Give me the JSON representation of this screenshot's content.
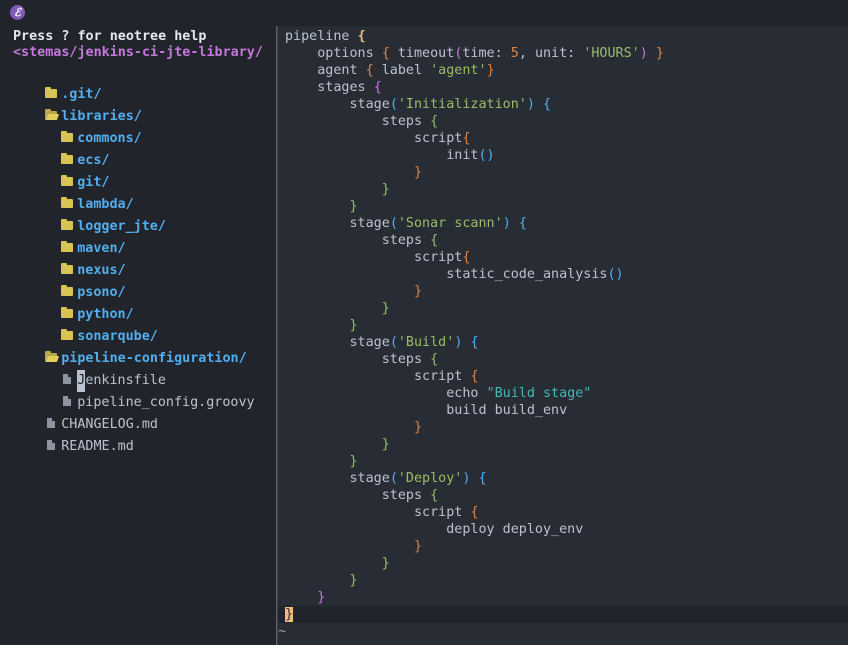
{
  "app": {
    "logo_glyph": "ℰ"
  },
  "sidebar": {
    "help_text": "Press ? for neotree help",
    "root": "<stemas/jenkins-ci-jte-library/",
    "entries": [
      {
        "label": ".git/",
        "type": "dir",
        "depth": 0
      },
      {
        "label": "libraries/",
        "type": "dir-open",
        "depth": 0
      },
      {
        "label": "commons/",
        "type": "dir",
        "depth": 1
      },
      {
        "label": "ecs/",
        "type": "dir",
        "depth": 1
      },
      {
        "label": "git/",
        "type": "dir",
        "depth": 1
      },
      {
        "label": "lambda/",
        "type": "dir",
        "depth": 1
      },
      {
        "label": "logger_jte/",
        "type": "dir",
        "depth": 1
      },
      {
        "label": "maven/",
        "type": "dir",
        "depth": 1
      },
      {
        "label": "nexus/",
        "type": "dir",
        "depth": 1
      },
      {
        "label": "psono/",
        "type": "dir",
        "depth": 1
      },
      {
        "label": "python/",
        "type": "dir",
        "depth": 1
      },
      {
        "label": "sonarqube/",
        "type": "dir",
        "depth": 1
      },
      {
        "label": "pipeline-configuration/",
        "type": "dir-open",
        "depth": 0
      },
      {
        "label": "Jenkinsfile",
        "type": "file",
        "depth": 1,
        "cursor_char": "J",
        "rest": "enkinsfile"
      },
      {
        "label": "pipeline_config.groovy",
        "type": "file",
        "depth": 1
      },
      {
        "label": "CHANGELOG.md",
        "type": "file",
        "depth": 0
      },
      {
        "label": "README.md",
        "type": "file",
        "depth": 0
      }
    ]
  },
  "editor": {
    "tilde": "~",
    "lines": [
      "pipeline {",
      "    options { timeout(time: 5, unit: 'HOURS') }",
      "    agent { label 'agent'}",
      "    stages {",
      "        stage('Initialization') {",
      "            steps {",
      "                script{",
      "                    init()",
      "                }",
      "            }",
      "        }",
      "        stage('Sonar scann') {",
      "            steps {",
      "                script{",
      "                    static_code_analysis()",
      "                }",
      "            }",
      "        }",
      "        stage('Build') {",
      "            steps {",
      "                script {",
      "                    echo \"Build stage\"",
      "                    build build_env",
      "                }",
      "            }",
      "        }",
      "        stage('Deploy') {",
      "            steps {",
      "                script {",
      "                    deploy deploy_env",
      "                }",
      "            }",
      "        }",
      "    }",
      "}"
    ],
    "tokens": {
      "pipeline": "pipeline",
      "options": "options",
      "timeout": "timeout",
      "time_kw": "time:",
      "time_val": "5",
      "unit_kw": "unit:",
      "unit_val": "'HOURS'",
      "agent": "agent",
      "label": "label",
      "agent_val": "'agent'",
      "stages": "stages",
      "stage": "stage",
      "steps": "steps",
      "script": "script",
      "stage1": "'Initialization'",
      "init": "init",
      "stage2": "'Sonar scann'",
      "sca": "static_code_analysis",
      "stage3": "'Build'",
      "echo": "echo",
      "echo_val": "\"Build stage\"",
      "build": "build build_env",
      "stage4": "'Deploy'",
      "deploy": "deploy deploy_env"
    }
  }
}
